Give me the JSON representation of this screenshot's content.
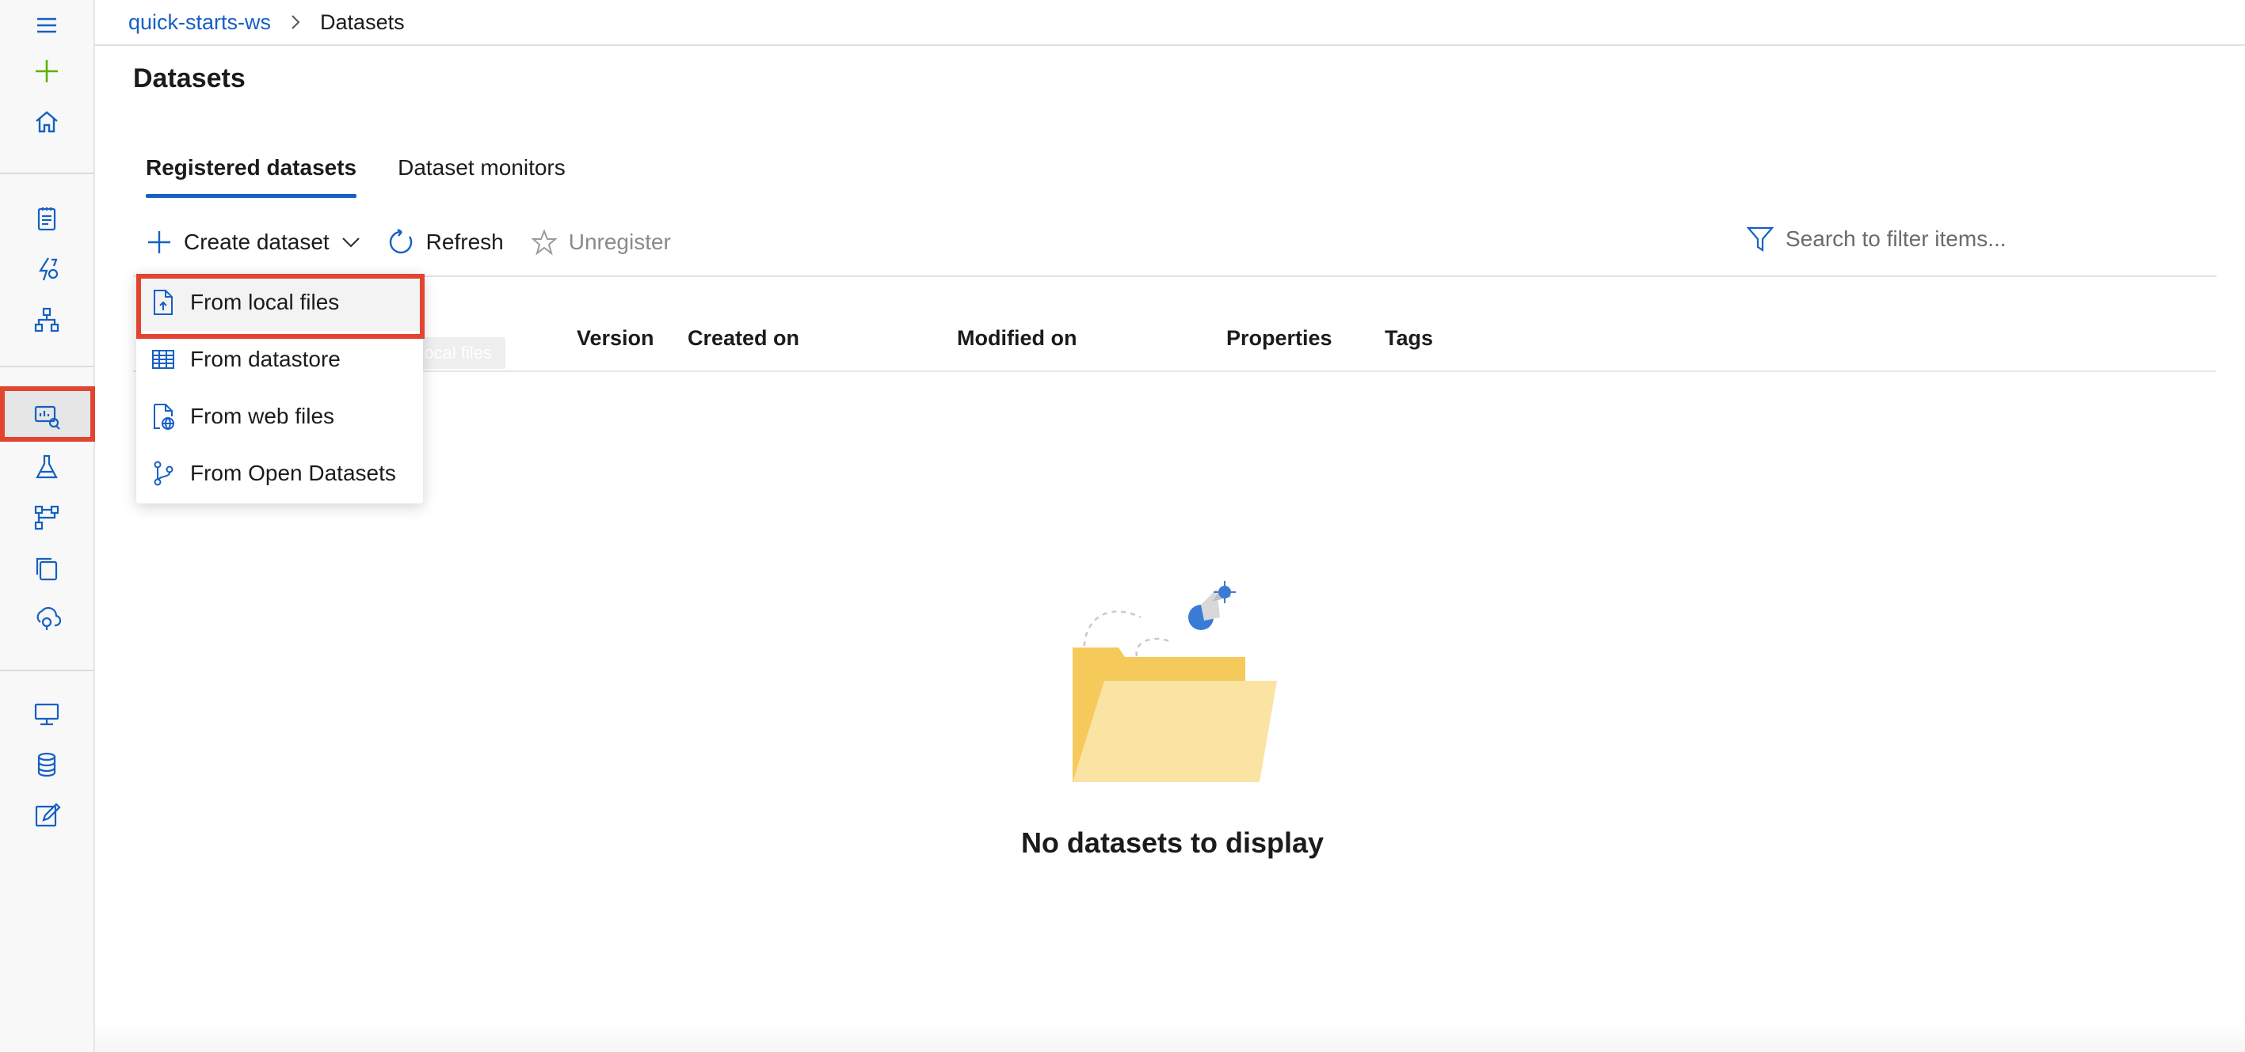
{
  "breadcrumb": {
    "workspace": "quick-starts-ws",
    "current": "Datasets"
  },
  "page": {
    "title": "Datasets"
  },
  "tabs": [
    {
      "label": "Registered datasets",
      "active": true
    },
    {
      "label": "Dataset monitors",
      "active": false
    }
  ],
  "toolbar": {
    "create_label": "Create dataset",
    "refresh_label": "Refresh",
    "unregister_label": "Unregister"
  },
  "search": {
    "placeholder": "Search to filter items..."
  },
  "table": {
    "columns": [
      "Version",
      "Created on",
      "Modified on",
      "Properties",
      "Tags"
    ]
  },
  "create_menu": {
    "items": [
      {
        "label": "From local files",
        "icon": "upload-file-icon"
      },
      {
        "label": "From datastore",
        "icon": "table-icon"
      },
      {
        "label": "From web files",
        "icon": "web-file-icon"
      },
      {
        "label": "From Open Datasets",
        "icon": "branch-icon"
      }
    ]
  },
  "tooltip": {
    "text": "From local files"
  },
  "empty_state": {
    "message": "No datasets to display"
  },
  "rail": {
    "items": [
      "menu-icon",
      "new-icon",
      "home-icon",
      "notebook-icon",
      "automl-icon",
      "designer-icon",
      "datasets-icon",
      "experiments-icon",
      "pipelines-icon",
      "models-icon",
      "endpoints-icon",
      "compute-icon",
      "datastores-icon",
      "labeling-icon"
    ]
  },
  "colors": {
    "accent": "#1560c4",
    "highlight": "#e2442f",
    "folder": "#f5c95a",
    "plus_green": "#5db300"
  }
}
